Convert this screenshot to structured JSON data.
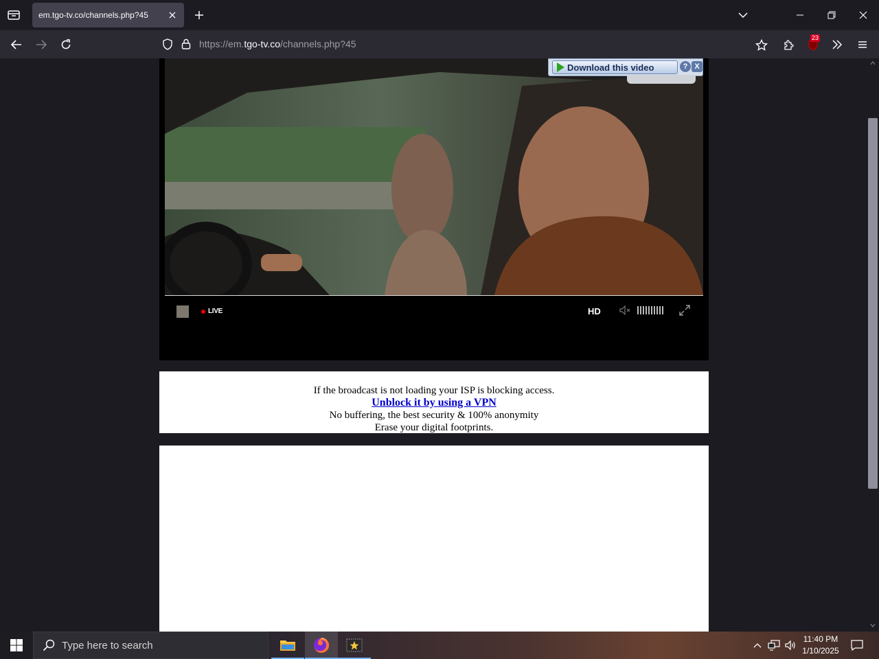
{
  "browser": {
    "tab_title": "em.tgo-tv.co/channels.php?45",
    "url_prefix": "https://",
    "url_host_pre": "em.",
    "url_host": "tgo-tv.co",
    "url_path": "/channels.php?45",
    "extension_badge": "23"
  },
  "player": {
    "download_label": "Download this video",
    "help_label": "?",
    "close_label": "X",
    "live_label": "LIVE",
    "hd_label": "HD"
  },
  "vpn_notice": {
    "line1": "If the broadcast is not loading your ISP is blocking access.",
    "link": "Unblock it by using a VPN",
    "line3": "No buffering, the best security & 100% anonymity",
    "line4": "Erase your digital footprints."
  },
  "taskbar": {
    "search_placeholder": "Type here to search",
    "time": "11:40 PM",
    "date": "1/10/2025"
  }
}
